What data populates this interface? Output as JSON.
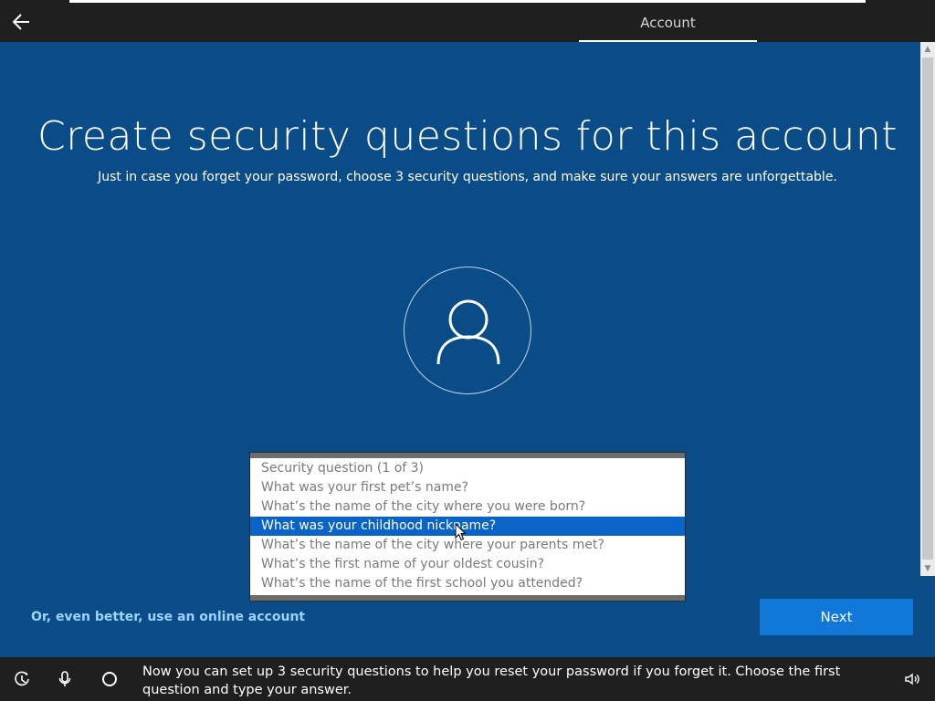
{
  "header": {
    "tab_account": "Account",
    "back_icon": "back-arrow-icon"
  },
  "main": {
    "title": "Create security questions for this account",
    "subtitle": "Just in case you forget your password, choose 3 security questions, and make sure your answers are unforgettable.",
    "avatar_icon": "user-icon"
  },
  "dropdown": {
    "options": [
      "Security question (1 of 3)",
      "What was your first pet’s name?",
      "What’s the name of the city where you were born?",
      "What was your childhood nickname?",
      "What’s the name of the city where your parents met?",
      "What’s the first name of your oldest cousin?",
      "What’s the name of the first school you attended?"
    ],
    "selected_index": 3
  },
  "actions": {
    "online_account_link": "Or, even better, use an online account",
    "next_label": "Next"
  },
  "bottom_bar": {
    "message": "Now you can set up 3 security questions to help you reset your password if you forget it. Choose the first question and type your answer.",
    "icons": [
      "ease-of-access-icon",
      "microphone-icon",
      "cortana-icon",
      "volume-icon"
    ]
  },
  "colors": {
    "background": "#0a4c87",
    "accent": "#0f78d8",
    "selection": "#0a64c8",
    "link": "#9dd3ff"
  }
}
